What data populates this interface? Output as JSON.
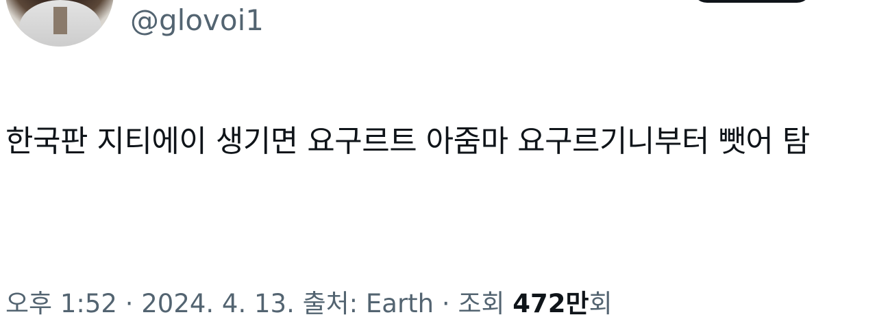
{
  "header": {
    "handle": "@glovoi1"
  },
  "tweet": {
    "text": "한국판 지티에이 생기면 요구르트 아줌마 요구르기니부터 뺏어 탐"
  },
  "meta": {
    "time": "오후 1:52",
    "sep1": " · ",
    "date": "2024. 4. 13.",
    "source_label": " 출처: ",
    "source": "Earth",
    "sep2": " · ",
    "views_label": "조회 ",
    "views_count": "472만",
    "views_suffix": "회"
  }
}
